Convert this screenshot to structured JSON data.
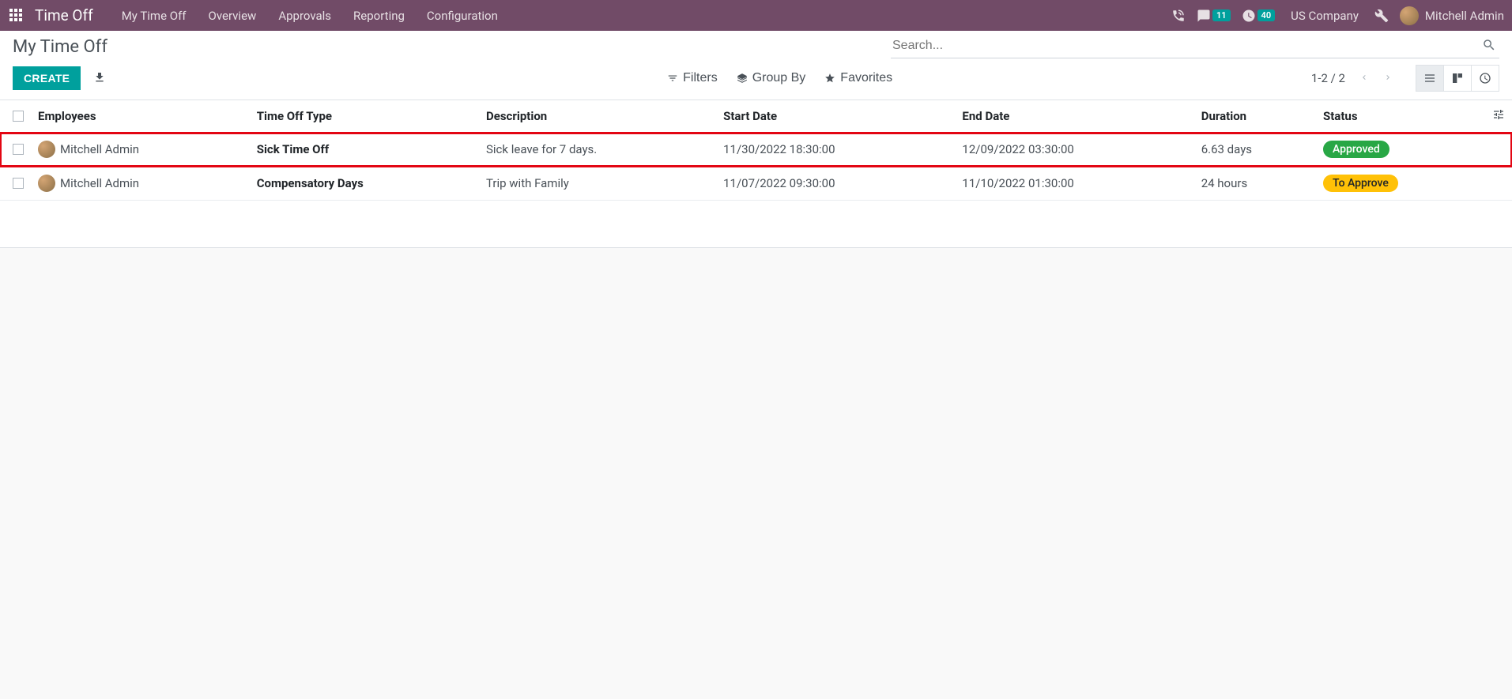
{
  "topnav": {
    "brand": "Time Off",
    "links": [
      "My Time Off",
      "Overview",
      "Approvals",
      "Reporting",
      "Configuration"
    ],
    "messages_badge": "11",
    "activities_badge": "40",
    "company": "US Company",
    "username": "Mitchell Admin"
  },
  "breadcrumb": "My Time Off",
  "search": {
    "placeholder": "Search..."
  },
  "buttons": {
    "create": "CREATE",
    "filters": "Filters",
    "groupby": "Group By",
    "favorites": "Favorites"
  },
  "pager": "1-2 / 2",
  "table": {
    "headers": {
      "employees": "Employees",
      "type": "Time Off Type",
      "description": "Description",
      "start": "Start Date",
      "end": "End Date",
      "duration": "Duration",
      "status": "Status"
    },
    "rows": [
      {
        "employee": "Mitchell Admin",
        "type": "Sick Time Off",
        "description": "Sick leave for 7 days.",
        "start": "11/30/2022 18:30:00",
        "end": "12/09/2022 03:30:00",
        "duration": "6.63 days",
        "status": "Approved",
        "status_class": "approved",
        "highlighted": true
      },
      {
        "employee": "Mitchell Admin",
        "type": "Compensatory Days",
        "description": "Trip with Family",
        "start": "11/07/2022 09:30:00",
        "end": "11/10/2022 01:30:00",
        "duration": "24 hours",
        "status": "To Approve",
        "status_class": "toapprove",
        "highlighted": false
      }
    ]
  }
}
